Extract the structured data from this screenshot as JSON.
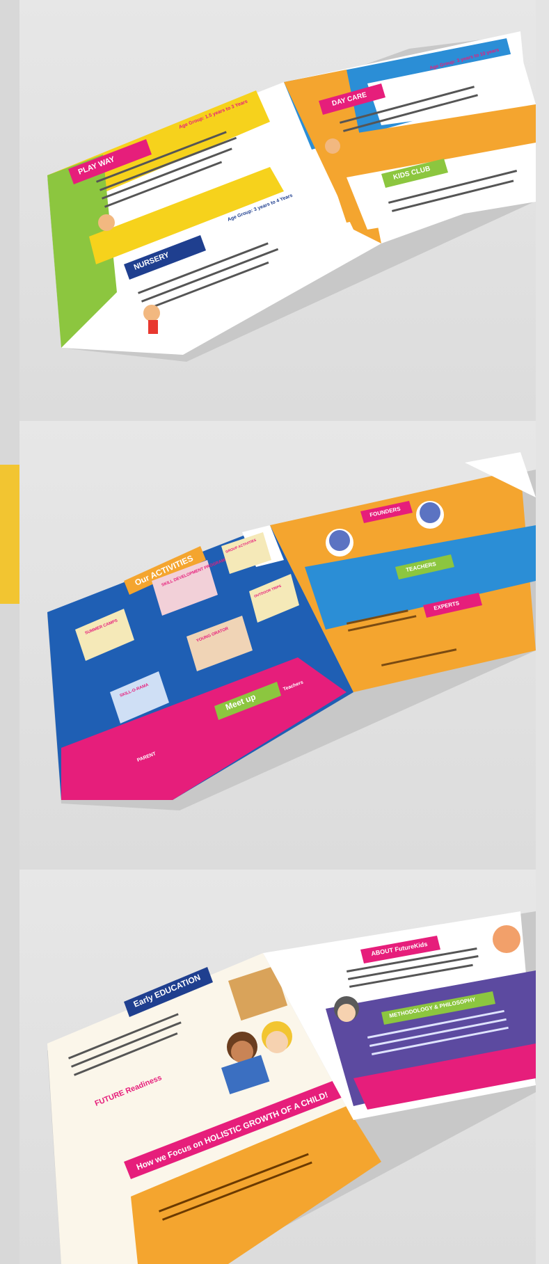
{
  "spread1": {
    "play_way": {
      "title": "PLAY WAY",
      "age": "Age Group: 1.5 years to 3 Years"
    },
    "nursery": {
      "title": "NURSERY",
      "age": "Age Group: 3 years to 4 Years"
    },
    "day_care": {
      "title": "DAY CARE",
      "age": "Age Group: 3 years to 10 years"
    },
    "kids_club": {
      "title": "KIDS CLUB"
    }
  },
  "spread2": {
    "activities_title": "Our ACTIVITIES",
    "activities": [
      "SUMMER CAMPS",
      "SKILL DEVELOPMENT PROGRAMS",
      "GROUP ACTIVITIES",
      "SKILL-O-RAMA",
      "YOUNG ORATOR",
      "OUTDOOR TRIPS"
    ],
    "meet_up": "Meet up",
    "parent": "PARENT",
    "teachers_label": "Teachers",
    "founders": "FOUNDERS",
    "teachers": "TEACHERS",
    "experts": "EXPERTS"
  },
  "spread3": {
    "early_education": "Early EDUCATION",
    "future_readiness": "FUTURE Readiness",
    "focus": "How we Focus on HOLISTIC GROWTH OF A CHILD!",
    "about": "ABOUT FutureKids",
    "methodology": "METHODOLOGY & PHILOSOPHY"
  },
  "colors": {
    "yellow": "#f6d21c",
    "green": "#8cc63f",
    "pink": "#e61e7b",
    "navy": "#1f3f8f",
    "blue": "#2b8ed6",
    "orange": "#f4a52f",
    "purple": "#5c4aa0"
  }
}
